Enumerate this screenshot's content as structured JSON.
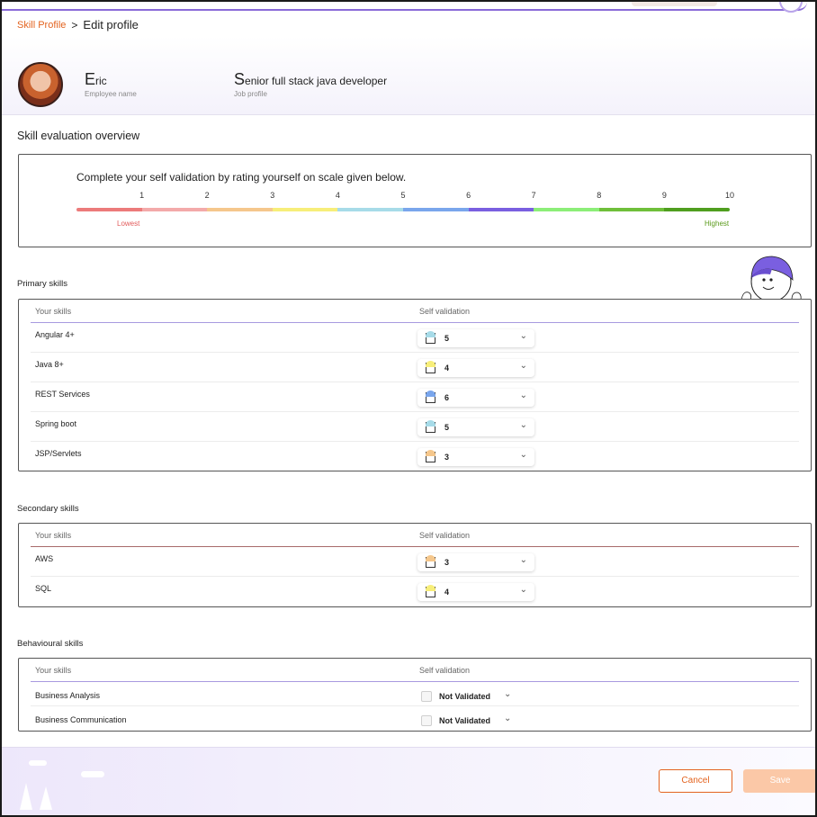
{
  "breadcrumb": {
    "link": "Skill Profile",
    "separator": ">",
    "current": "Edit profile"
  },
  "profile": {
    "name": "Eric",
    "name_caption": "Employee name",
    "job": "Senior full stack java developer",
    "job_caption": "Job profile"
  },
  "overview": {
    "title": "Skill evaluation overview",
    "instruction": "Complete your self validation by rating yourself on scale given below.",
    "scale_numbers": [
      "1",
      "2",
      "3",
      "4",
      "5",
      "6",
      "7",
      "8",
      "9",
      "10"
    ],
    "scale_colors": [
      "#ec7b7b",
      "#f3aaaa",
      "#f5c78c",
      "#f7ee7a",
      "#a7dbe8",
      "#7aa6ec",
      "#7a5fe0",
      "#8cee78",
      "#6fbf3a",
      "#4f9e1f"
    ],
    "lowest": "Lowest",
    "highest": "Highest"
  },
  "columns": {
    "skill": "Your skills",
    "validation": "Self validation"
  },
  "primary": {
    "title": "Primary skills",
    "rows": [
      {
        "skill": "Angular 4+",
        "value": "5",
        "color": "#a7dbe8"
      },
      {
        "skill": "Java 8+",
        "value": "4",
        "color": "#f7ee7a"
      },
      {
        "skill": "REST Services",
        "value": "6",
        "color": "#7aa6ec"
      },
      {
        "skill": "Spring boot",
        "value": "5",
        "color": "#a7dbe8"
      },
      {
        "skill": "JSP/Servlets",
        "value": "3",
        "color": "#f5c78c"
      }
    ]
  },
  "secondary": {
    "title": "Secondary skills",
    "rows": [
      {
        "skill": "AWS",
        "value": "3",
        "color": "#f5c78c"
      },
      {
        "skill": "SQL",
        "value": "4",
        "color": "#f7ee7a"
      }
    ]
  },
  "behavioural": {
    "title": "Behavioural skills",
    "rows": [
      {
        "skill": "Business Analysis",
        "value": "Not Validated"
      },
      {
        "skill": "Business Communication",
        "value": "Not Validated"
      }
    ]
  },
  "icons": {
    "dropdown": "chevron-down-icon",
    "rating": "rating-cup-icon",
    "mascot": "mascot-icon"
  },
  "actions": {
    "cancel": "Cancel",
    "save": "Save"
  }
}
